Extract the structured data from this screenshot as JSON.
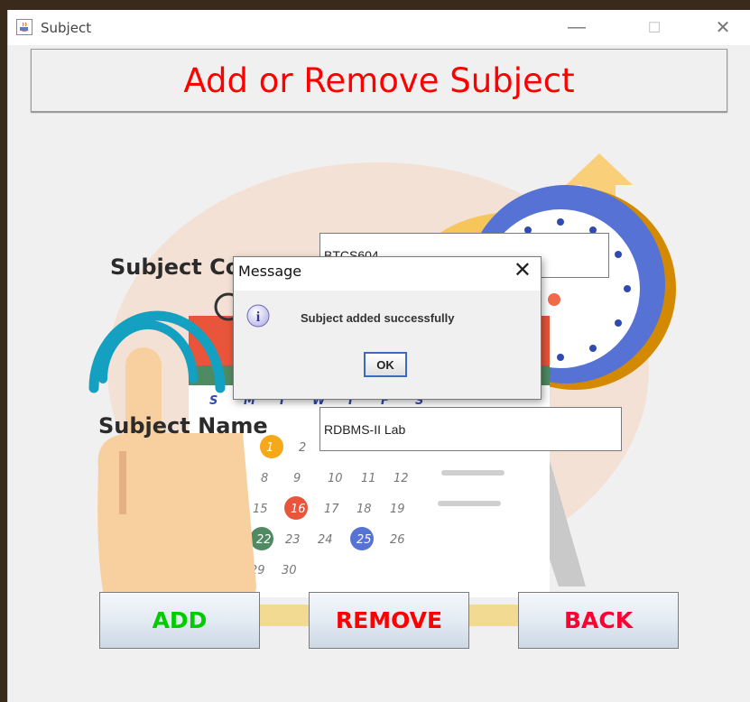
{
  "window": {
    "title": "Subject",
    "minimize_glyph": "—",
    "maximize_glyph": "☐",
    "close_glyph": "✕"
  },
  "header": {
    "title": "Add or Remove Subject",
    "color": "#ff0000"
  },
  "form": {
    "subject_code_label": "Subject Code",
    "subject_code_value": "BTCS604",
    "subject_name_label": "Subject Name",
    "subject_name_value": "RDBMS-II Lab"
  },
  "buttons": {
    "add": {
      "label": "ADD",
      "color": "#00cc00"
    },
    "remove": {
      "label": "REMOVE",
      "color": "#ff0000"
    },
    "back": {
      "label": "BACK",
      "color": "#ff0033"
    }
  },
  "dialog": {
    "title": "Message",
    "close_glyph": "✕",
    "message": "Subject added successfully",
    "ok_label": "OK",
    "icon": "info-icon"
  },
  "calendar": {
    "weekdays": [
      "S",
      "M",
      "T",
      "W",
      "T",
      "F",
      "S"
    ],
    "rows": [
      [
        "1",
        "2"
      ],
      [
        "8",
        "9",
        "10",
        "11",
        "12"
      ],
      [
        "15",
        "16",
        "17",
        "18",
        "19"
      ],
      [
        "22",
        "23",
        "24",
        "25",
        "26"
      ],
      [
        "29",
        "30"
      ]
    ]
  }
}
